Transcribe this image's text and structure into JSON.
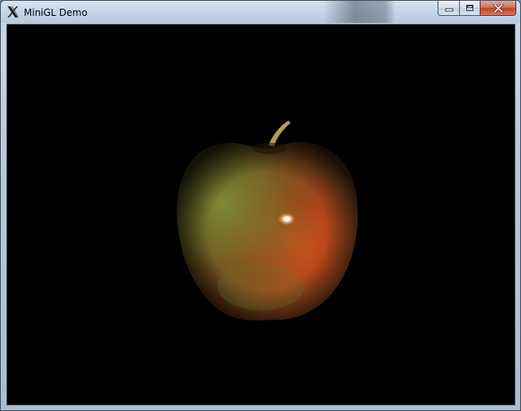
{
  "window": {
    "title": "MiniGL Demo",
    "app_icon": "x-window-icon"
  },
  "caption_buttons": {
    "minimize_icon": "minimize-icon",
    "maximize_icon": "maximize-icon",
    "close_icon": "close-icon"
  },
  "scene": {
    "background_color": "#000000",
    "object": "apple",
    "apple_colors": {
      "highlight": "#ffffff",
      "red": "#c2461a",
      "green": "#7b8a36",
      "stem": "#b7a35a"
    }
  }
}
